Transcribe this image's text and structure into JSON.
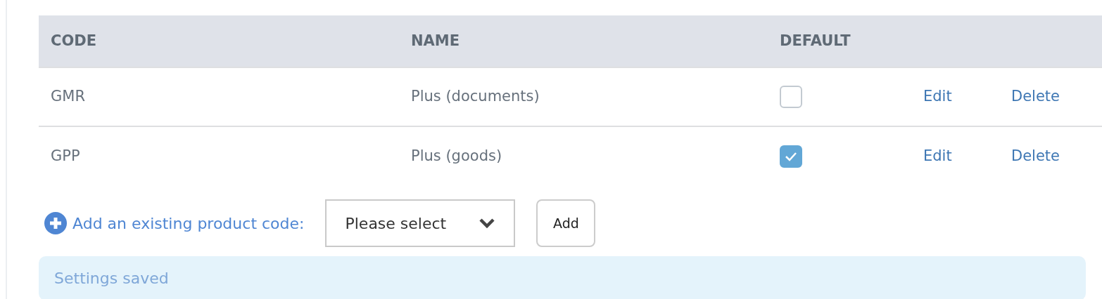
{
  "table": {
    "columns": [
      "CODE",
      "NAME",
      "DEFAULT"
    ],
    "rows": [
      {
        "code": "GMR",
        "name": "Plus (documents)",
        "default": false,
        "actions": [
          "Edit",
          "Delete"
        ]
      },
      {
        "code": "GPP",
        "name": "Plus (goods)",
        "default": true,
        "actions": [
          "Edit",
          "Delete"
        ]
      }
    ]
  },
  "add_row": {
    "label": "Add an existing product code:",
    "select": {
      "value": "Please select"
    },
    "button": "Add"
  },
  "alert": {
    "text": "Settings saved"
  }
}
